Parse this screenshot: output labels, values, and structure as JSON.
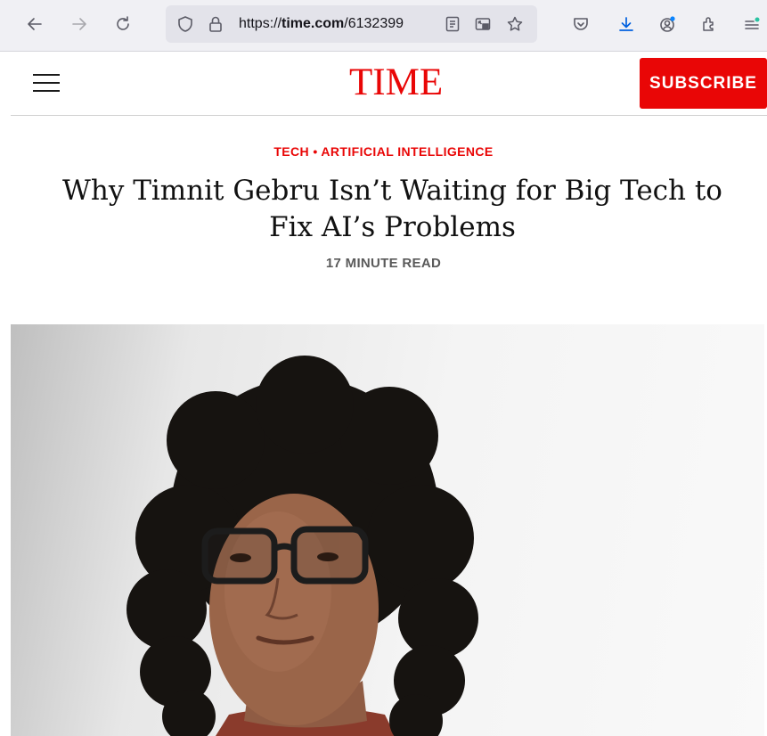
{
  "browser": {
    "url_prefix": "https://",
    "url_domain": "time.com",
    "url_path": "/6132399"
  },
  "site": {
    "logo": "TIME",
    "subscribe_label": "SUBSCRIBE"
  },
  "article": {
    "kicker": "TECH • ARTIFICIAL INTELLIGENCE",
    "headline_line1": "Why Timnit Gebru Isn’t Waiting for Big Tech to",
    "headline_line2": "Fix AI’s Problems",
    "read_time": "17 MINUTE READ"
  },
  "colors": {
    "brand_red": "#e90606",
    "toolbar_bg": "#f0f0f4",
    "urlbar_bg": "#e3e3ea"
  },
  "icons": [
    "back-icon",
    "forward-icon",
    "reload-icon",
    "shield-icon",
    "lock-icon",
    "reader-view-icon",
    "picture-in-picture-icon",
    "bookmark-star-icon",
    "pocket-icon",
    "download-icon",
    "account-icon",
    "extensions-icon",
    "app-menu-icon",
    "hamburger-menu-icon"
  ]
}
